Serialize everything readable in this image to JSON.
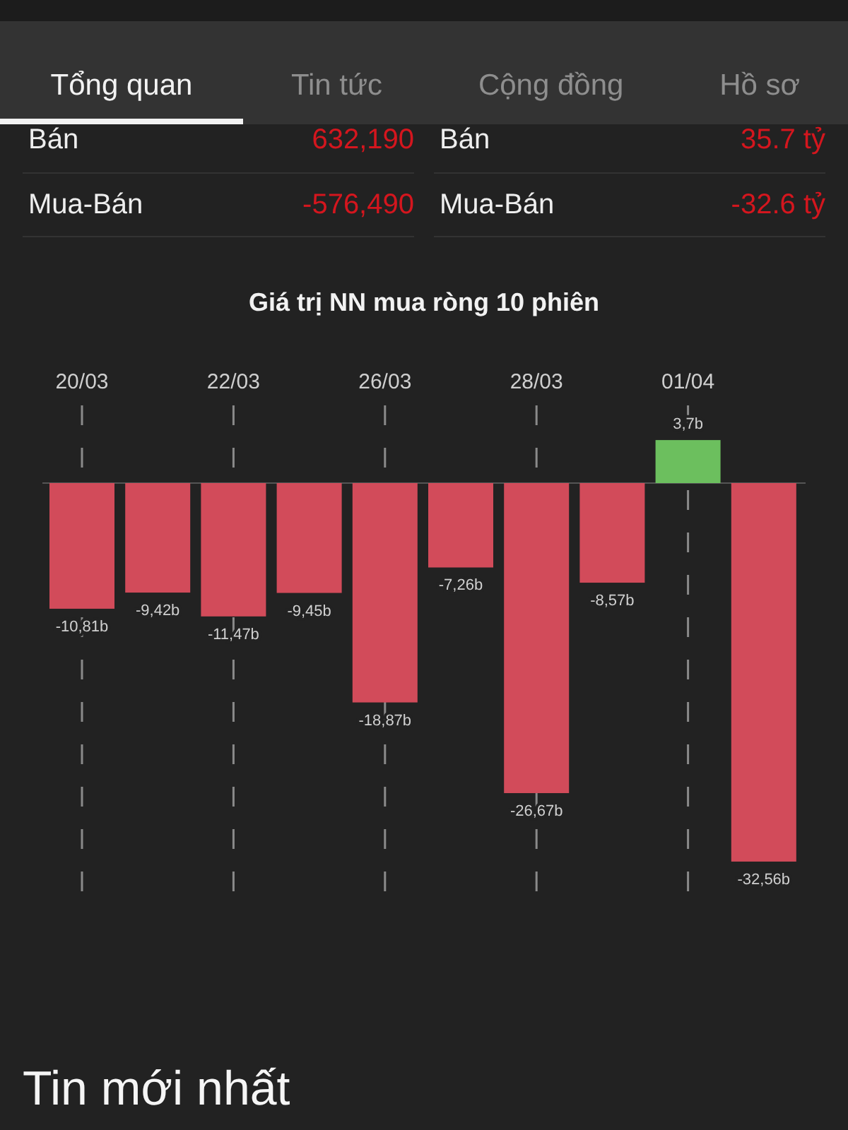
{
  "tabs": [
    {
      "label": "Tổng quan",
      "selected": true
    },
    {
      "label": "Tin tức",
      "selected": false
    },
    {
      "label": "Cộng đồng",
      "selected": false
    },
    {
      "label": "Hồ sơ",
      "selected": false
    }
  ],
  "stats": [
    {
      "rows": [
        {
          "label": "Bán",
          "value": "632,190"
        },
        {
          "label": "Mua-Bán",
          "value": "-576,490"
        }
      ]
    },
    {
      "rows": [
        {
          "label": "Bán",
          "value": "35.7 tỷ"
        },
        {
          "label": "Mua-Bán",
          "value": "-32.6 tỷ"
        }
      ]
    }
  ],
  "chart": {
    "chart_data": {
      "type": "bar",
      "title": "Giá trị NN mua ròng 10 phiên",
      "grid": true,
      "categories": [
        "20/03",
        null,
        "22/03",
        null,
        "26/03",
        null,
        "28/03",
        null,
        "01/04",
        null
      ],
      "values": [
        -10.81,
        -9.42,
        -11.47,
        -9.45,
        -18.87,
        -7.26,
        -26.67,
        -8.57,
        3.7,
        -32.56
      ],
      "value_labels": [
        "-10,81b",
        "-9,42b",
        "-11,47b",
        "-9,45b",
        "-18,87b",
        "-7,26b",
        "-26,67b",
        "-8,57b",
        "3,7b",
        "-32,56b"
      ]
    }
  },
  "news": {
    "heading": "Tin mới nhất"
  }
}
